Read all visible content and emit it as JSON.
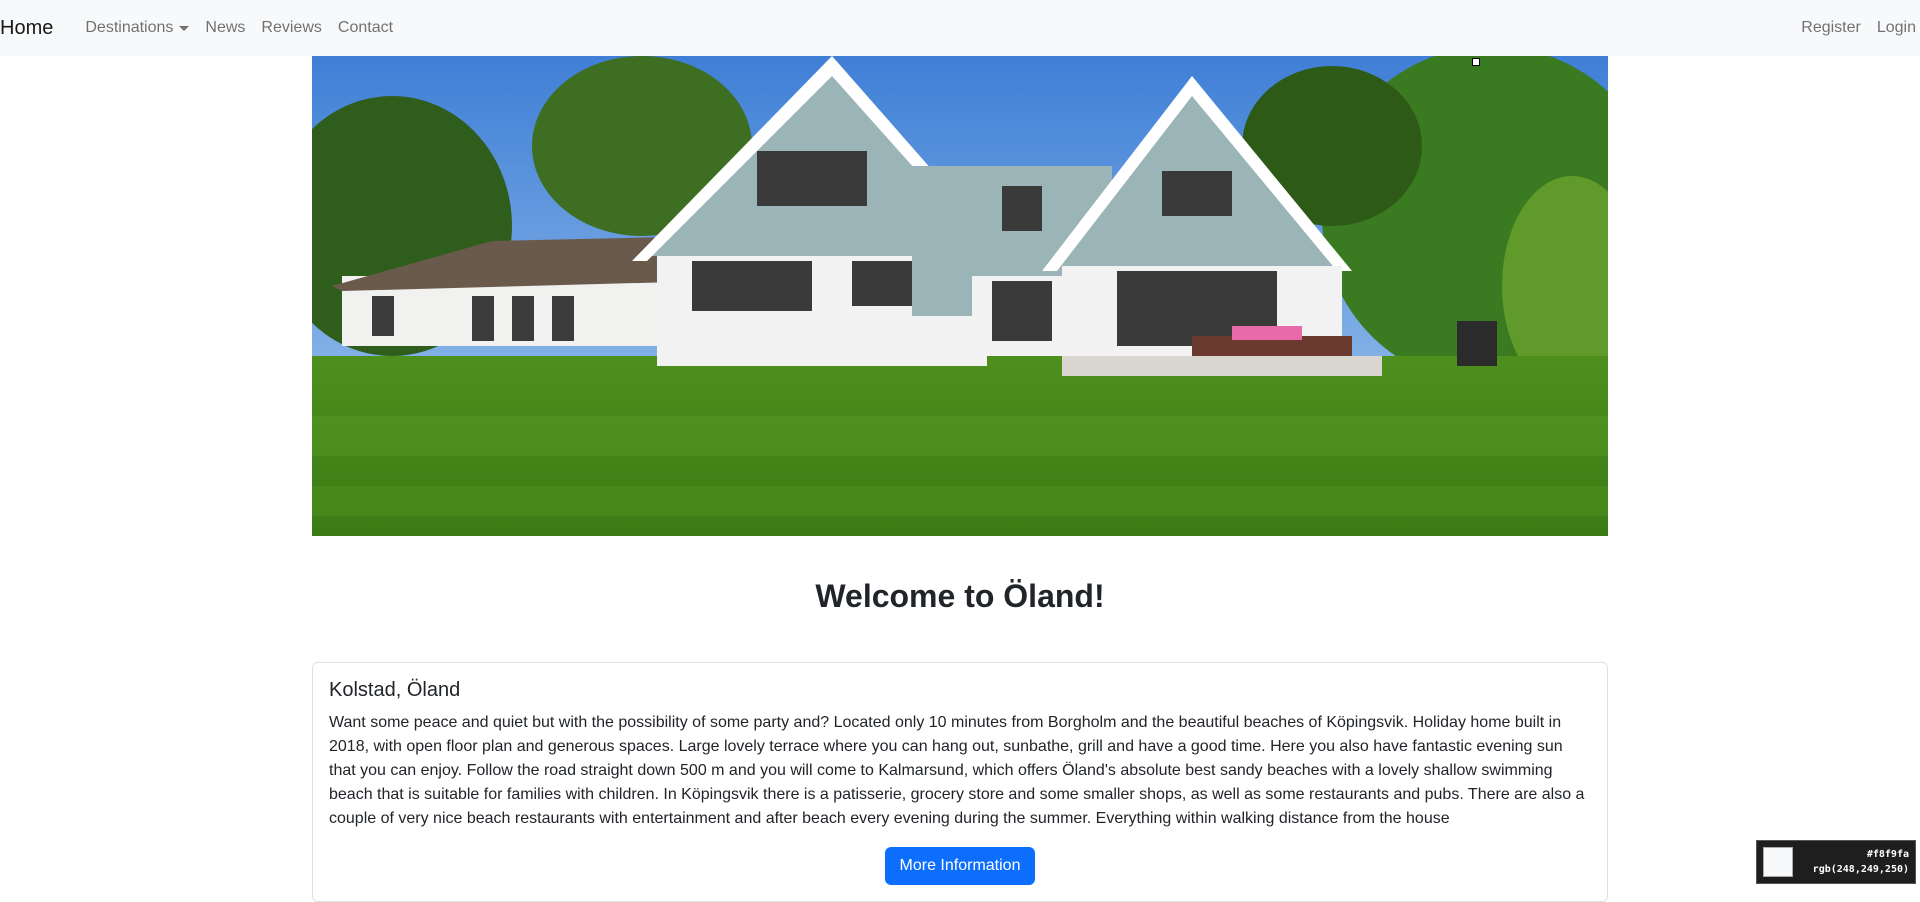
{
  "navbar": {
    "brand": "Home",
    "left_links": [
      {
        "label": "Destinations"
      },
      {
        "label": "News"
      },
      {
        "label": "Reviews"
      },
      {
        "label": "Contact"
      }
    ],
    "right_links": [
      {
        "label": "Register"
      },
      {
        "label": "Login"
      }
    ]
  },
  "hero": {
    "image": "house-with-lawn-photo"
  },
  "main": {
    "heading": "Welcome to Öland!"
  },
  "card": {
    "title": "Kolstad, Öland",
    "text": "Want some peace and quiet but with the possibility of some party and? Located only 10 minutes from Borgholm and the beautiful beaches of Köpingsvik. Holiday home built in 2018, with open floor plan and generous spaces. Large lovely terrace where you can hang out, sunbathe, grill and have a good time. Here you also have fantastic evening sun that you can enjoy. Follow the road straight down 500 m and you will come to Kalmarsund, which offers Öland's absolute best sandy beaches with a lovely shallow swimming beach that is suitable for families with children. In Köpingsvik there is a patisserie, grocery store and some smaller shops, as well as some restaurants and pubs. There are also a couple of very nice beach restaurants with entertainment and after beach every evening during the summer. Everything within walking distance from the house",
    "button_label": "More Information"
  },
  "color_picker": {
    "hex": "#f8f9fa",
    "rgb": "rgb(248,249,250)"
  },
  "colors": {
    "navbar_bg": "#f8f9fa",
    "primary": "#0d6efd"
  }
}
